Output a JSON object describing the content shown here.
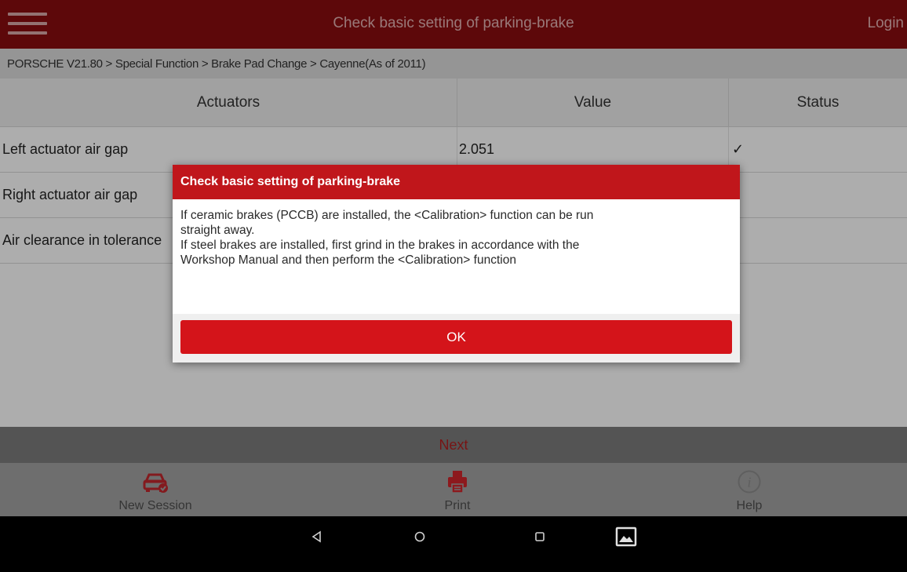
{
  "header": {
    "title": "Check basic setting of parking-brake",
    "login_label": "Login"
  },
  "breadcrumb": "PORSCHE V21.80 > Special Function > Brake Pad Change > Cayenne(As of 2011)",
  "table": {
    "headers": [
      "Actuators",
      "Value",
      "Status"
    ],
    "rows": [
      {
        "actuator": "Left actuator air gap",
        "value": "2.051",
        "status": "✓"
      },
      {
        "actuator": "Right actuator air gap",
        "value": "",
        "status": ""
      },
      {
        "actuator": "Air clearance in tolerance",
        "value": "",
        "status": ""
      }
    ]
  },
  "next_label": "Next",
  "bottom_nav": [
    {
      "label": "New Session",
      "icon": "car-check-icon"
    },
    {
      "label": "Print",
      "icon": "printer-icon"
    },
    {
      "label": "Help",
      "icon": "info-icon"
    }
  ],
  "dialog": {
    "title": "Check basic setting of parking-brake",
    "lines": [
      "If ceramic brakes (PCCB) are installed, the <Calibration> function  can be run",
      "straight away.",
      "If steel brakes are installed, first grind in the brakes in accordance with the",
      "Workshop Manual and then perform the <Calibration> function"
    ],
    "ok_label": "OK"
  },
  "system_bar": [
    "back-icon",
    "home-icon",
    "recents-icon",
    "screenshot-icon"
  ],
  "colors": {
    "brand_dark": "#8a0d10",
    "brand": "#c0161b",
    "button": "#d4141a"
  }
}
